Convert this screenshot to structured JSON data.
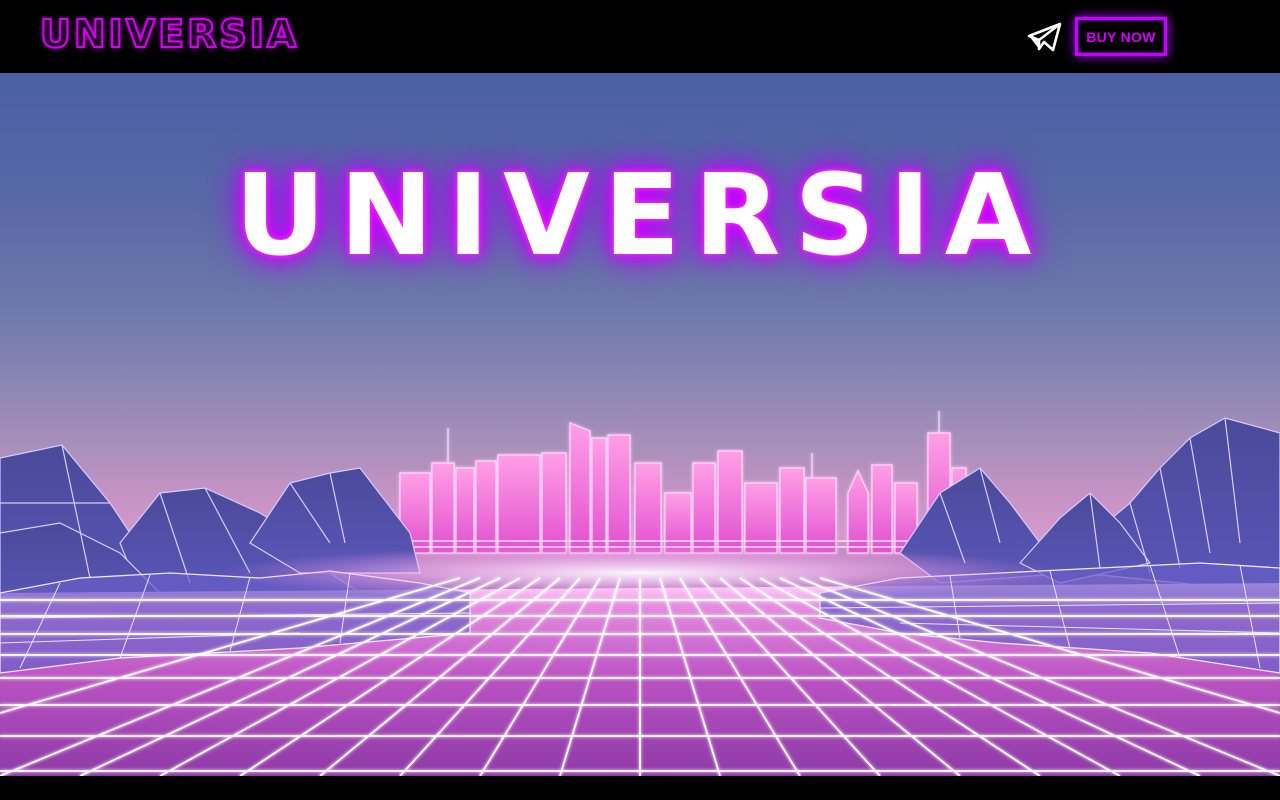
{
  "header": {
    "logo_text": "UNIVERSIA",
    "send_icon": "telegram-paper-plane-icon",
    "buy_button_label": "BUY NOW"
  },
  "hero": {
    "title": "UNIVERSIA",
    "scene": "synthwave-neon-city-grid"
  },
  "colors": {
    "neon_magenta": "#d400f0",
    "neon_purple": "#c400ff",
    "sky_top": "#4a5fa4",
    "grid_pink": "#ff7fe8",
    "mountain_blue": "#3d3f8a"
  }
}
